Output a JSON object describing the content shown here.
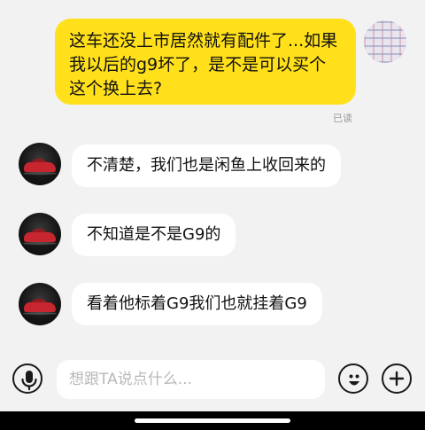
{
  "conversation": {
    "outgoing": {
      "lines": [
        "这车还没上市居然就有配件了...如果",
        "我以后的g9坏了，是不是可以买个",
        "这个换上去?"
      ],
      "read_status": "已读"
    },
    "incoming": [
      {
        "text": "不清楚，我们也是闲鱼上收回来的"
      },
      {
        "text": "不知道是不是G9的"
      },
      {
        "text": "看着他标着G9我们也就挂着G9"
      }
    ]
  },
  "input_bar": {
    "placeholder": "想跟TA说点什么...",
    "voice_icon": "microphone-icon",
    "emoji_icon": "emoji-icon",
    "add_icon": "plus-icon"
  },
  "colors": {
    "outgoing_bubble": "#ffe01a",
    "incoming_bubble": "#ffffff",
    "background": "#f2f2f2",
    "read_status": "#9a9a9a"
  }
}
